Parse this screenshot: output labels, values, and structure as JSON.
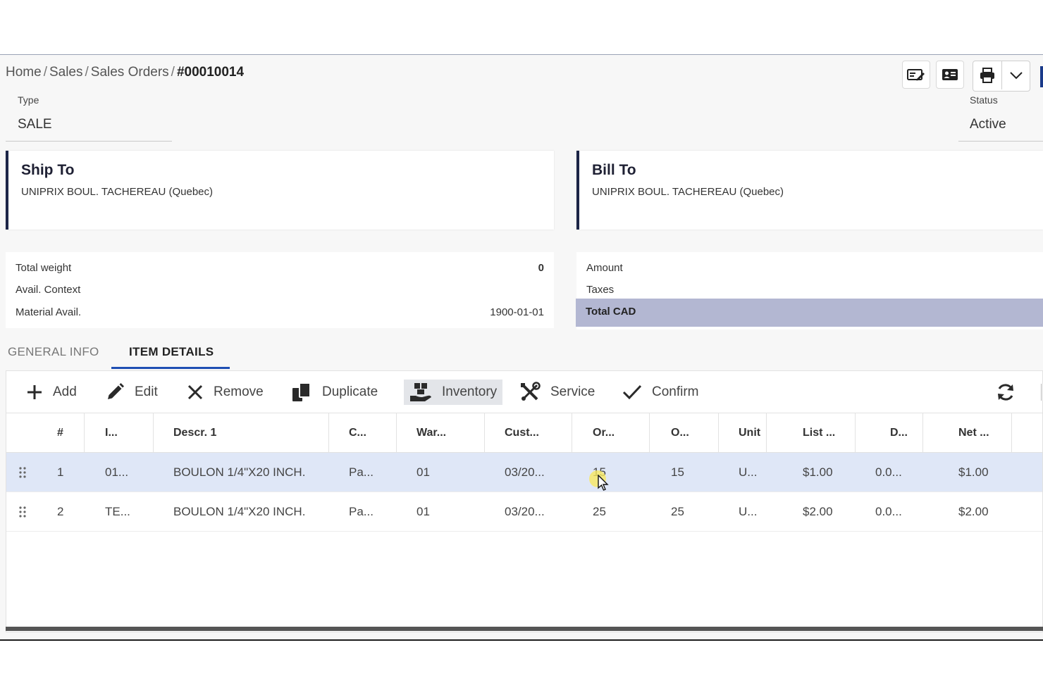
{
  "breadcrumb": {
    "home": "Home",
    "sales": "Sales",
    "sales_orders": "Sales Orders",
    "current": "#00010014",
    "separator": "/"
  },
  "header_icons": [
    "edit-card-icon",
    "contact-card-icon",
    "print-icon",
    "chevron-down-icon"
  ],
  "type_field": {
    "label": "Type",
    "value": "SALE"
  },
  "status_field": {
    "label": "Status",
    "value": "Active"
  },
  "ship_to": {
    "title": "Ship To",
    "address": "UNIPRIX BOUL. TACHEREAU (Quebec)"
  },
  "bill_to": {
    "title": "Bill To",
    "address": "UNIPRIX BOUL. TACHEREAU (Quebec)"
  },
  "left_summary": [
    {
      "label": "Total weight",
      "value": "0"
    },
    {
      "label": "Avail. Context",
      "value": ""
    },
    {
      "label": "Material Avail.",
      "value": "1900-01-01"
    }
  ],
  "right_summary": {
    "amount": "Amount",
    "taxes": "Taxes",
    "total": "Total CAD"
  },
  "tabs": {
    "general": "GENERAL INFO",
    "items": "ITEM DETAILS",
    "active": "ITEM DETAILS"
  },
  "toolbar": {
    "add": "Add",
    "edit": "Edit",
    "remove": "Remove",
    "duplicate": "Duplicate",
    "inventory": "Inventory",
    "service": "Service",
    "confirm": "Confirm"
  },
  "table": {
    "headers": [
      "#",
      "I...",
      "Descr. 1",
      "C...",
      "War...",
      "Cust...",
      "Or...",
      "O...",
      "Unit",
      "List ...",
      "D...",
      "Net ..."
    ],
    "rows": [
      [
        "1",
        "01...",
        "BOULON 1/4\"X20 INCH.",
        "Pa...",
        "01",
        "03/20...",
        "15",
        "15",
        "U...",
        "$1.00",
        "0.0...",
        "$1.00"
      ],
      [
        "2",
        "TE...",
        "BOULON 1/4\"X20 INCH.",
        "Pa...",
        "01",
        "03/20...",
        "25",
        "25",
        "U...",
        "$2.00",
        "0.0...",
        "$2.00"
      ]
    ],
    "selected_row": 1
  },
  "colors": {
    "accent": "#1f4fb3",
    "card_border": "#1c2547",
    "selected_row": "#dfe7f7",
    "total_row": "#b3b7d2"
  }
}
